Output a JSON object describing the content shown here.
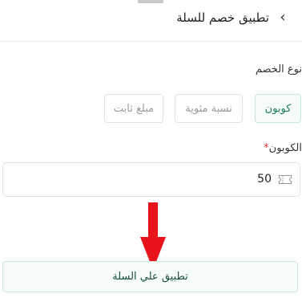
{
  "header": {
    "title": "تطبيق خصم للسلة",
    "back_glyph": "‹"
  },
  "discount_type": {
    "label": "نوع الخصم",
    "options": [
      {
        "label": "كوبون",
        "selected": true
      },
      {
        "label": "نسبة مئوية",
        "selected": false
      },
      {
        "label": "مبلغ ثابت",
        "selected": false
      }
    ]
  },
  "coupon": {
    "label": "الكوبون",
    "required_mark": "*",
    "value": "50",
    "icon": "ticket-icon"
  },
  "annotation": {
    "icon": "red-arrow-down",
    "color": "#e8141c"
  },
  "actions": {
    "apply_label": "تطبيق علي السلة"
  },
  "colors": {
    "accent": "#1f7a5c",
    "selected_bg": "#f4fbf8",
    "required": "#e53935"
  }
}
